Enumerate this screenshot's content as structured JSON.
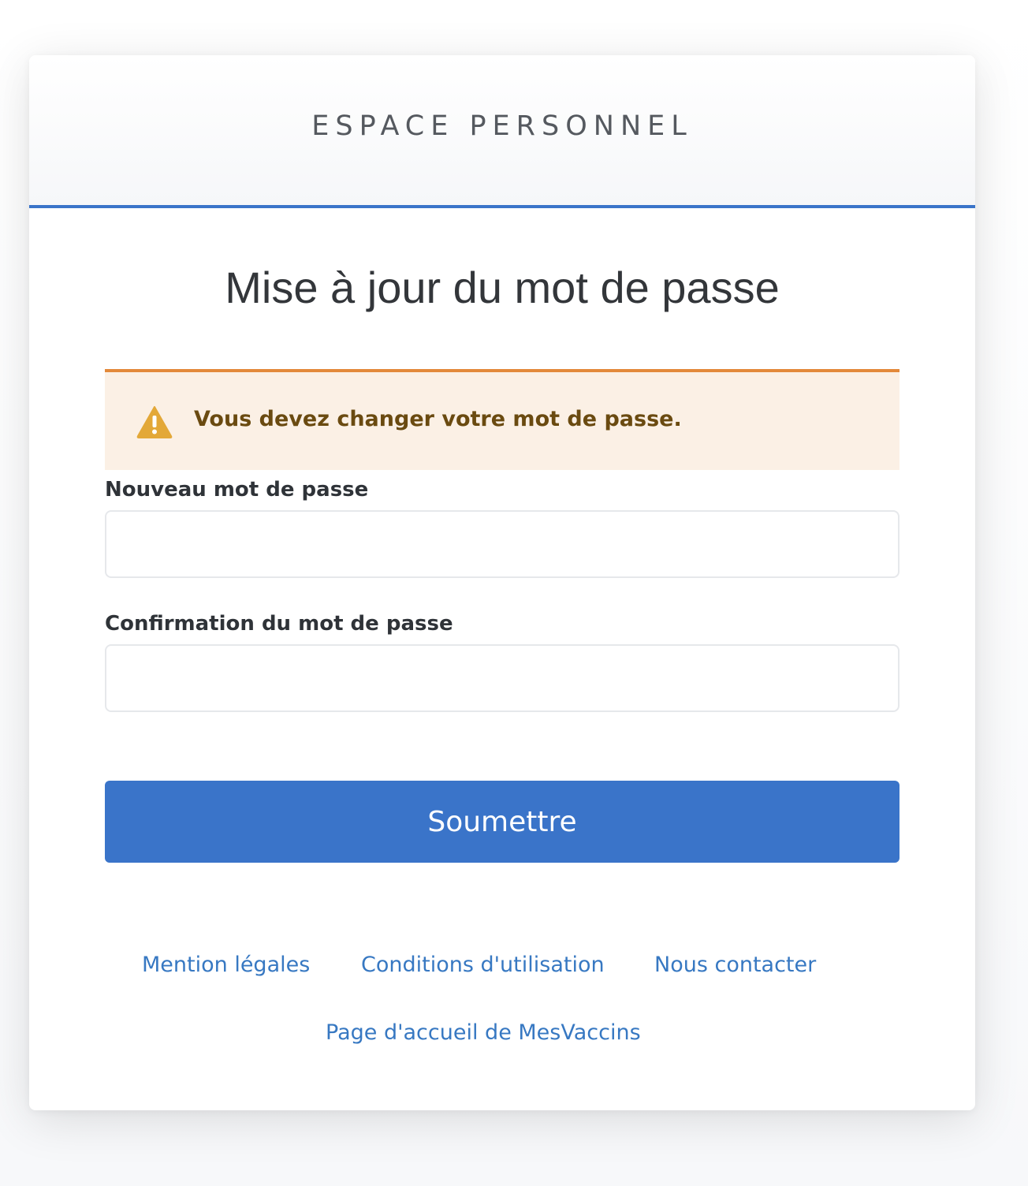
{
  "header": {
    "title": "ESPACE PERSONNEL"
  },
  "main": {
    "title": "Mise à jour du mot de passe",
    "alert": {
      "message": "Vous devez changer votre mot de passe.",
      "icon": "warning-icon",
      "color": "#e3a838"
    },
    "fields": {
      "new_password": {
        "label": "Nouveau mot de passe",
        "value": ""
      },
      "confirm_password": {
        "label": "Confirmation du mot de passe",
        "value": ""
      }
    },
    "submit_label": "Soumettre"
  },
  "footer": {
    "links": [
      {
        "label": "Mention légales"
      },
      {
        "label": "Conditions d'utilisation"
      },
      {
        "label": "Nous contacter"
      },
      {
        "label": "Page d'accueil de MesVaccins"
      }
    ]
  },
  "colors": {
    "accent": "#3a74c9",
    "alert_border": "#e3893a",
    "alert_background": "#fbf0e5",
    "link": "#3778c2"
  }
}
